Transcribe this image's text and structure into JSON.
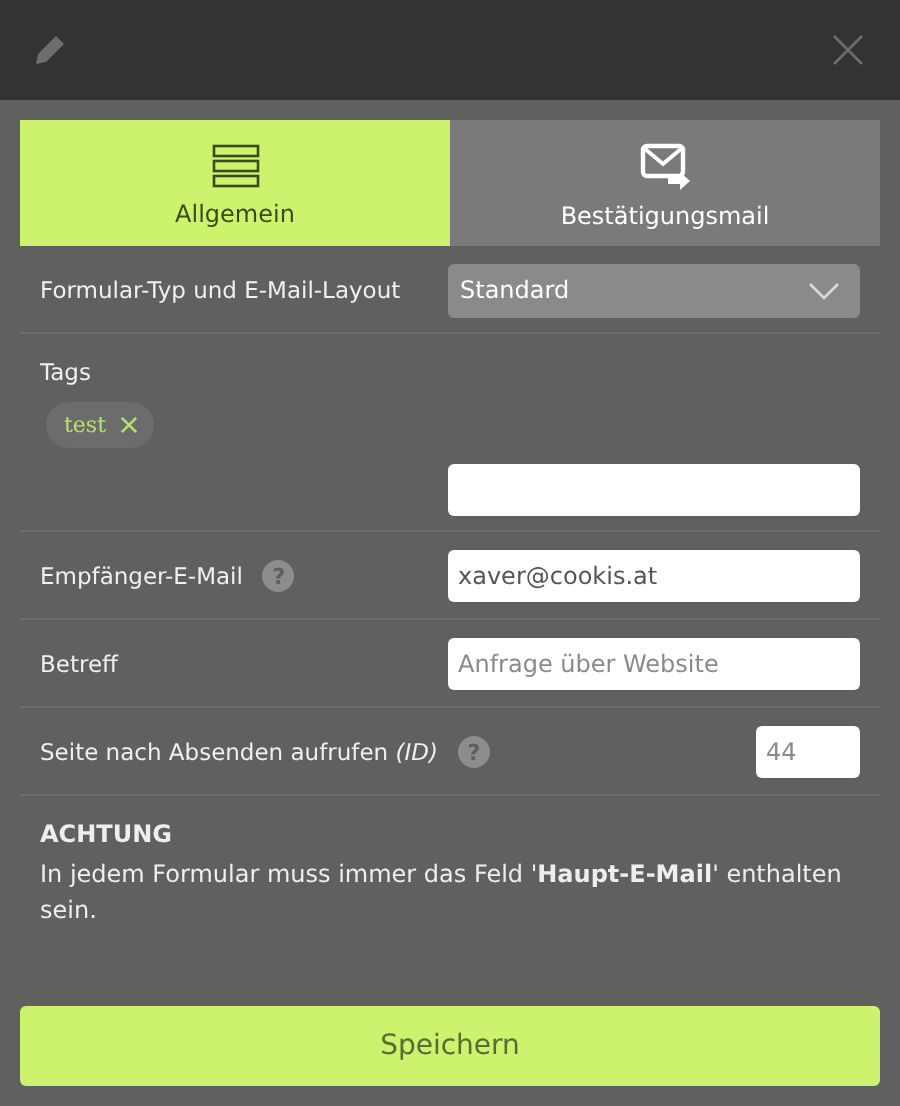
{
  "tabs": [
    {
      "label": "Allgemein",
      "kind": "list",
      "selected": true
    },
    {
      "label": "Bestätigungsmail",
      "kind": "mail",
      "selected": false
    }
  ],
  "form_type": {
    "label": "Formular-Typ und E-Mail-Layout",
    "value": "Standard"
  },
  "tags": {
    "label": "Tags",
    "items": [
      "test"
    ]
  },
  "recipient": {
    "label": "Empfänger-E-Mail",
    "value": "xaver@cookis.at",
    "help": "?"
  },
  "subject": {
    "label": "Betreff",
    "placeholder": "Anfrage über Website"
  },
  "redirect": {
    "label": "Seite nach Absenden aufrufen *(ID)*",
    "placeholder": "44",
    "help": "?"
  },
  "notice": {
    "title": "ACHTUNG",
    "text": "In jedem Formular muss immer das Feld '**Haupt-E-Mail**' enthalten sein."
  },
  "save_button": "Speichern"
}
